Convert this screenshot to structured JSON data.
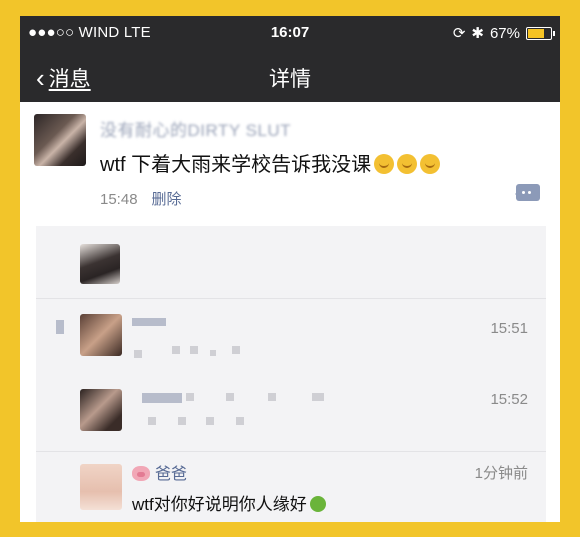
{
  "status_bar": {
    "carrier": "●●●○○ WIND  LTE",
    "time": "16:07",
    "battery": "67%",
    "battery_level": 0.67
  },
  "nav": {
    "back_label": "消息",
    "title": "详情"
  },
  "post": {
    "author": "没有耐心的DIRTY SLUT",
    "content": "wtf 下着大雨来学校告诉我没课",
    "time": "15:48",
    "delete_label": "删除"
  },
  "comments": [
    {
      "time": "15:51"
    },
    {
      "time": "15:52"
    },
    {
      "name": "爸爸",
      "time": "1分钟前",
      "text": "wtf对你好说明你人缘好"
    }
  ],
  "colors": {
    "accent_link": "#586b95",
    "header": "#2a2a2c",
    "frame": "#f2c52a"
  }
}
